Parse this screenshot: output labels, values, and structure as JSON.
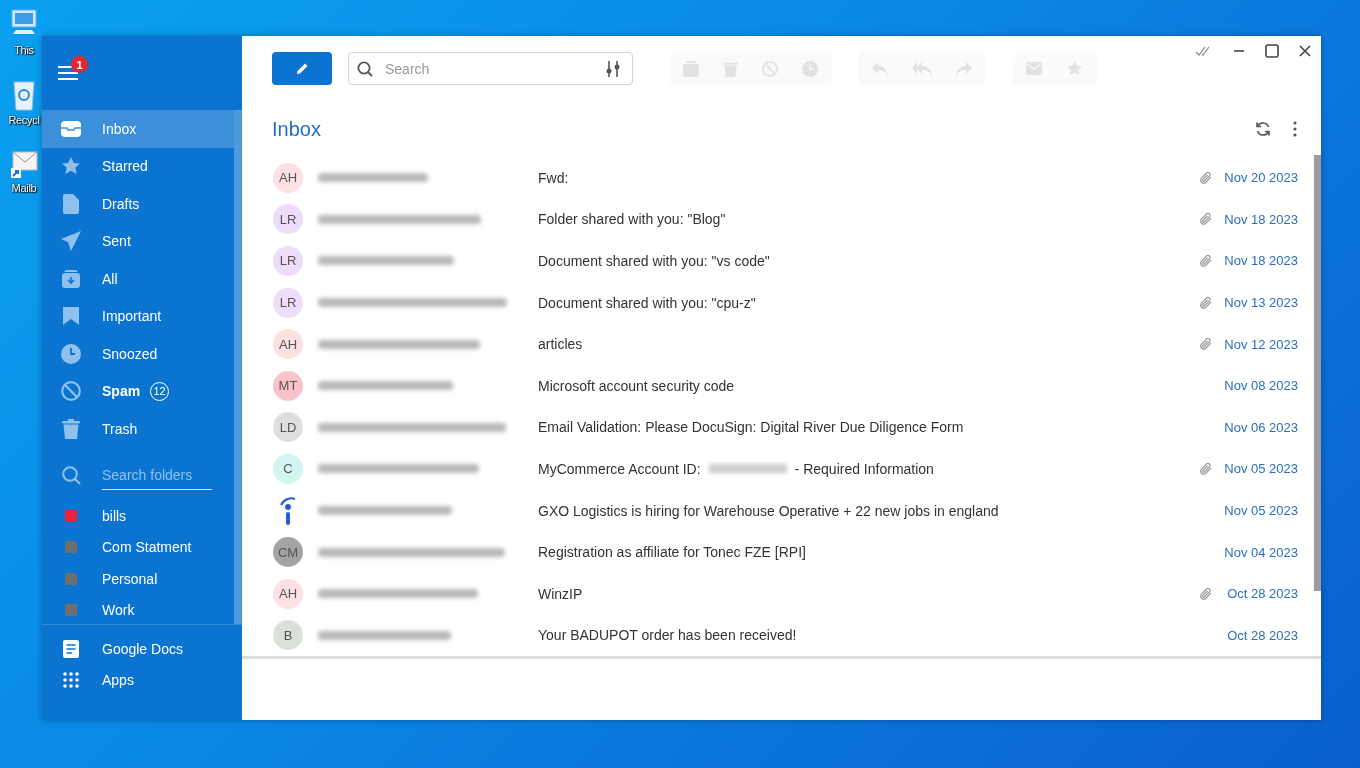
{
  "desktop_icons": [
    {
      "kind": "computer",
      "label": "This"
    },
    {
      "kind": "recycle",
      "label": "Recycl"
    },
    {
      "kind": "mail",
      "label": "Mailb"
    }
  ],
  "sidebar": {
    "menu_badge": "1",
    "folders": [
      {
        "label": "Inbox",
        "selected": true,
        "bold": false
      },
      {
        "label": "Starred",
        "selected": false,
        "bold": false
      },
      {
        "label": "Drafts",
        "selected": false,
        "bold": false
      },
      {
        "label": "Sent",
        "selected": false,
        "bold": false
      },
      {
        "label": "All",
        "selected": false,
        "bold": false
      },
      {
        "label": "Important",
        "selected": false,
        "bold": false
      },
      {
        "label": "Snoozed",
        "selected": false,
        "bold": false
      },
      {
        "label": "Spam",
        "selected": false,
        "bold": true,
        "count": "12"
      },
      {
        "label": "Trash",
        "selected": false,
        "bold": false
      }
    ],
    "search_placeholder": "Search folders",
    "labels": [
      {
        "label": "bills",
        "color": "#f0203c"
      },
      {
        "label": "Com Statment",
        "color": "#6e6e6e"
      },
      {
        "label": "Personal",
        "color": "#6e6e6e"
      },
      {
        "label": "Work",
        "color": "#6e6e6e"
      }
    ],
    "apps": [
      {
        "label": "Google Docs"
      },
      {
        "label": "Apps"
      }
    ]
  },
  "toolbar": {
    "search_placeholder": "Search"
  },
  "mailbox": {
    "title": "Inbox"
  },
  "emails": [
    {
      "kind": "initials",
      "initials": "AH",
      "color": "#fbe1e1",
      "subject": "Fwd:",
      "attachment": true,
      "date": "Nov 20 2023"
    },
    {
      "kind": "initials",
      "initials": "LR",
      "color": "#eedcf8",
      "subject": "Folder shared with you: \"Blog\"",
      "attachment": true,
      "date": "Nov 18 2023"
    },
    {
      "kind": "initials",
      "initials": "LR",
      "color": "#eedcf8",
      "subject": "Document shared with you: \"vs code\"",
      "attachment": true,
      "date": "Nov 18 2023"
    },
    {
      "kind": "initials",
      "initials": "LR",
      "color": "#eedcf8",
      "subject": "Document shared with you: \"cpu-z\"",
      "attachment": true,
      "date": "Nov 13 2023"
    },
    {
      "kind": "initials",
      "initials": "AH",
      "color": "#fbe1e1",
      "subject": "articles",
      "attachment": true,
      "date": "Nov 12 2023"
    },
    {
      "kind": "initials",
      "initials": "MT",
      "color": "#f9c3cb",
      "subject": "Microsoft account security code",
      "attachment": false,
      "date": "Nov 08 2023"
    },
    {
      "kind": "initials",
      "initials": "LD",
      "color": "#dedede",
      "subject": "Email Validation: Please DocuSign: Digital River Due Diligence Form",
      "attachment": false,
      "date": "Nov 06 2023"
    },
    {
      "kind": "initials",
      "initials": "C",
      "color": "#d3f5f1",
      "subject": "MyCommerce Account ID:",
      "redacted": true,
      "subject_after": "- Required Information",
      "attachment": true,
      "date": "Nov 05 2023"
    },
    {
      "kind": "logo",
      "subject": "GXO Logistics is hiring for Warehouse Operative + 22 new jobs in england",
      "attachment": false,
      "date": "Nov 05 2023"
    },
    {
      "kind": "initials",
      "initials": "CM",
      "color": "#a3a3a3",
      "subject": "Registration as affiliate for Tonec FZE [RPI]",
      "attachment": false,
      "date": "Nov 04 2023"
    },
    {
      "kind": "initials",
      "initials": "AH",
      "color": "#fbe1e1",
      "subject": "WinzIP",
      "attachment": true,
      "date": "Oct 28 2023"
    },
    {
      "kind": "initials",
      "initials": "B",
      "color": "#d9e1d9",
      "subject": "Your BADUPOT order has been received!",
      "attachment": false,
      "date": "Oct 28 2023"
    }
  ]
}
